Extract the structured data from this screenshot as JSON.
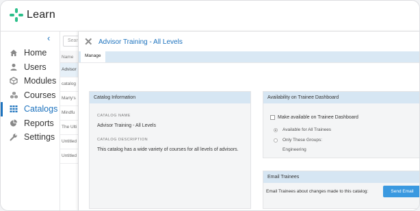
{
  "app": {
    "name": "Learn"
  },
  "sidebar": {
    "collapse_label": "‹",
    "items": [
      {
        "label": "Home",
        "icon": "home-icon"
      },
      {
        "label": "Users",
        "icon": "user-icon"
      },
      {
        "label": "Modules",
        "icon": "cube-icon"
      },
      {
        "label": "Courses",
        "icon": "cubes-icon"
      },
      {
        "label": "Catalogs",
        "icon": "grid-icon",
        "active": true
      },
      {
        "label": "Reports",
        "icon": "pie-chart-icon"
      },
      {
        "label": "Settings",
        "icon": "wrench-icon"
      }
    ]
  },
  "list": {
    "search_placeholder": "Sear",
    "header": "Name",
    "rows": [
      "Advisor",
      "catalog",
      "Marty's",
      "Mindfu",
      "The Ulti",
      "Untitled",
      "Untitled"
    ]
  },
  "panel": {
    "title": "Advisor Training - All Levels",
    "tab": "Manage",
    "catalog_info": {
      "heading": "Catalog Information",
      "name_label": "CATALOG NAME",
      "name_value": "Advisor Training - All Levels",
      "desc_label": "CATALOG DESCRIPTION",
      "desc_value": "This catalog has a wide variety of courses for all levels of advisors."
    },
    "availability": {
      "heading": "Availability on Trainee Dashboard",
      "checkbox_label": "Make available on Trainee Dashboard",
      "option_all": "Available for All Trainees",
      "option_groups": "Only These Groups:",
      "group_value": "Engineering"
    },
    "email": {
      "heading": "Email Trainees",
      "text": "Email Trainees about changes made to this catalog:",
      "button": "Send Email"
    }
  },
  "colors": {
    "accent": "#1e73be",
    "logo_green": "#2bbf8a",
    "button": "#3a99e0"
  }
}
